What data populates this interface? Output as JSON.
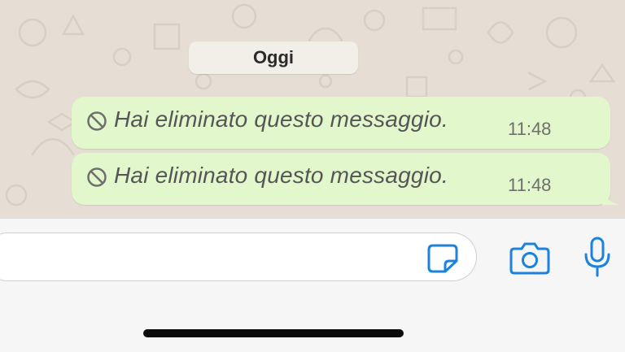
{
  "chat": {
    "date_label": "Oggi",
    "messages": [
      {
        "text": "Hai eliminato questo messaggio.",
        "time": "11:48",
        "icon": "deleted-message-icon"
      },
      {
        "text": "Hai eliminato questo messaggio.",
        "time": "11:48",
        "icon": "deleted-message-icon"
      }
    ]
  },
  "composer": {
    "input_value": "",
    "icons": [
      "sticker-icon",
      "camera-icon",
      "microphone-icon"
    ]
  },
  "colors": {
    "wallpaper": "#e6ded4",
    "bubble_outgoing": "#e2f7cb",
    "accent_blue": "#1c82e0",
    "input_bar": "#f6f6f6"
  }
}
